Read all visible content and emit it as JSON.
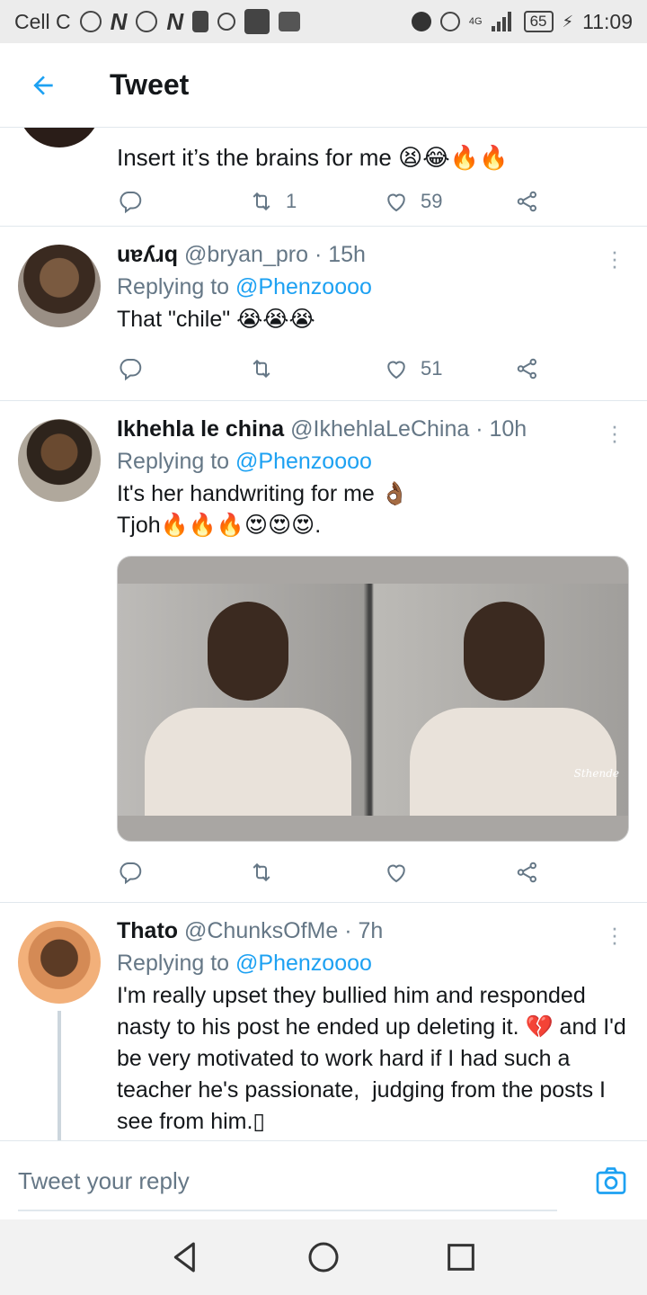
{
  "status_bar": {
    "carrier": "Cell C",
    "network": "4G",
    "battery": "65",
    "time": "11:09"
  },
  "header": {
    "title": "Tweet",
    "back_icon": "arrow-left-icon"
  },
  "tweets": [
    {
      "text": "Insert it’s the brains for me 😫😂🔥🔥",
      "retweets": "1",
      "likes": "59"
    },
    {
      "name": "uɐʎɹq",
      "handle": "@bryan_pro",
      "time": "· 15h",
      "replying_prefix": "Replying to ",
      "replying_to": "@Phenzoooo",
      "text": "That \"chile\" 😭😭😭",
      "retweets": "",
      "likes": "51"
    },
    {
      "name": "Ikhehla le china",
      "handle": "@IkhehlaLeChina",
      "time": "· 10h",
      "replying_prefix": "Replying to ",
      "replying_to": "@Phenzoooo",
      "text": "It's her handwriting for me 👌🏾\nTjoh🔥🔥🔥😍😍😍.",
      "media_watermark": "Sthende",
      "retweets": "",
      "likes": ""
    },
    {
      "name": "Thato",
      "handle": "@ChunksOfMe",
      "time": "· 7h",
      "replying_prefix": "Replying to ",
      "replying_to": "@Phenzoooo",
      "text": "I'm really upset they bullied him and responded nasty to his post he ended up deleting it. 💔 and I'd be very motivated to work hard if I had such a teacher he's passionate,  judging from the posts I see from him.▯"
    }
  ],
  "reply_bar": {
    "placeholder": "Tweet your reply"
  },
  "colors": {
    "accent": "#1da1f2",
    "secondary_text": "#657786",
    "border": "#e1e8ed"
  }
}
